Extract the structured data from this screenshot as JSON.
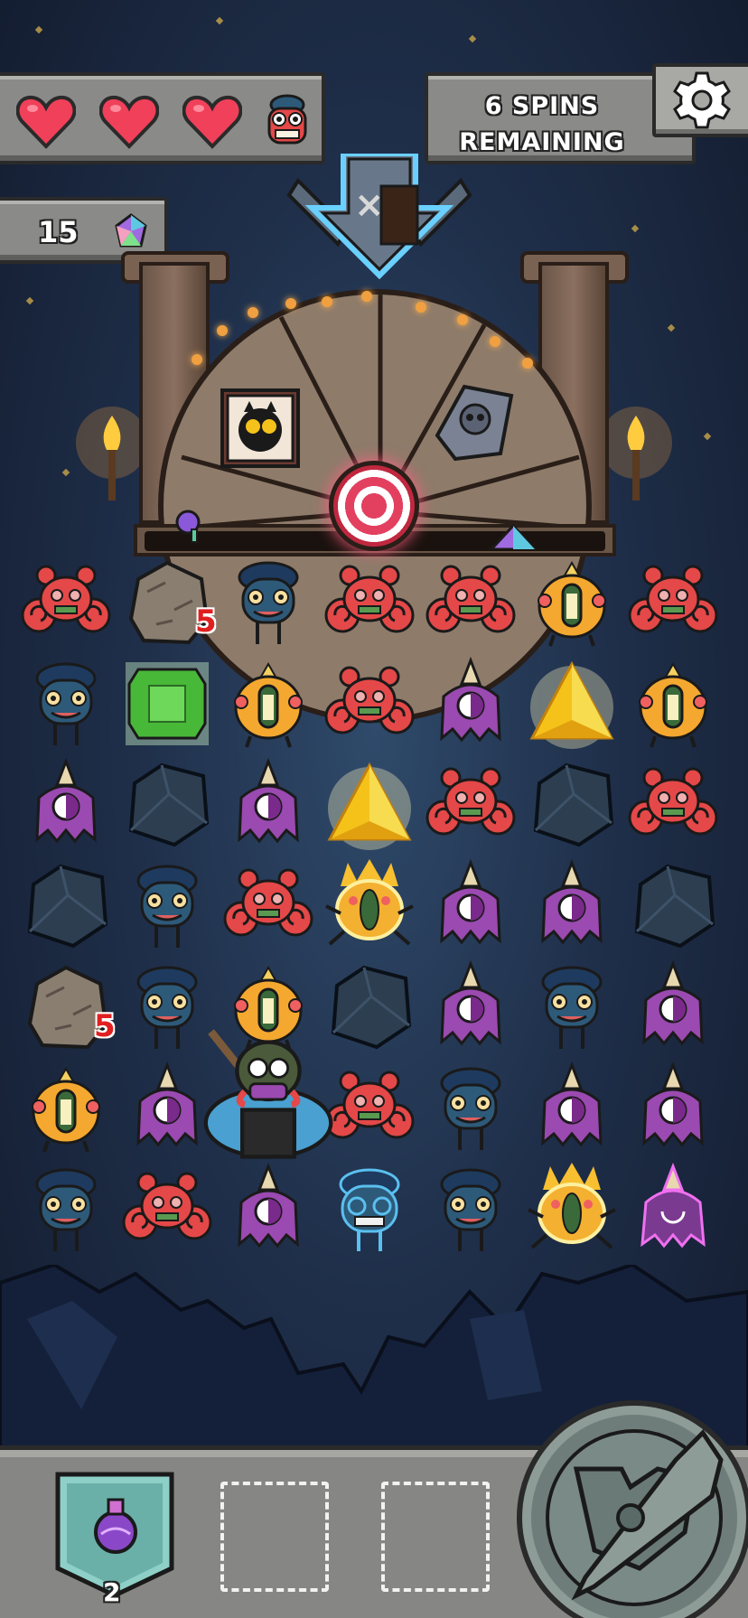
{
  "hud": {
    "lives": 3,
    "spins_line1": "6 SPINS",
    "spins_line2": "REMAINING",
    "gems": "15"
  },
  "board": {
    "badges": [
      "5",
      "5"
    ],
    "grid": [
      [
        "crab",
        "rock",
        "fish",
        "crab",
        "crab",
        "bug",
        "crab"
      ],
      [
        "fish",
        "green-gem",
        "bug",
        "crab",
        "squid",
        "gold-gem",
        "bug"
      ],
      [
        "squid",
        "stone",
        "squid",
        "gold-gem",
        "crab",
        "stone",
        "crab"
      ],
      [
        "stone",
        "fish",
        "crab",
        "fire-bug",
        "squid",
        "squid",
        "stone"
      ],
      [
        "rock",
        "fish",
        "bug",
        "stone",
        "squid",
        "fish",
        "squid"
      ],
      [
        "bug",
        "squid",
        "hero",
        "crab",
        "fish",
        "squid",
        "squid"
      ],
      [
        "fish",
        "crab",
        "squid",
        "fish-ghost",
        "fish",
        "fire-bug",
        "squid-ghost"
      ]
    ]
  },
  "inventory": {
    "potion_count": "2"
  },
  "colors": {
    "panel": "#8a8a88",
    "heart": "#f0405a",
    "crab": "#e44848",
    "fish": "#2e5a7a",
    "bug": "#f4a830",
    "squid": "#9a4ab0",
    "stone": "#2c3e50",
    "gold_gem": "#f5c21a",
    "green_gem": "#48b838"
  }
}
